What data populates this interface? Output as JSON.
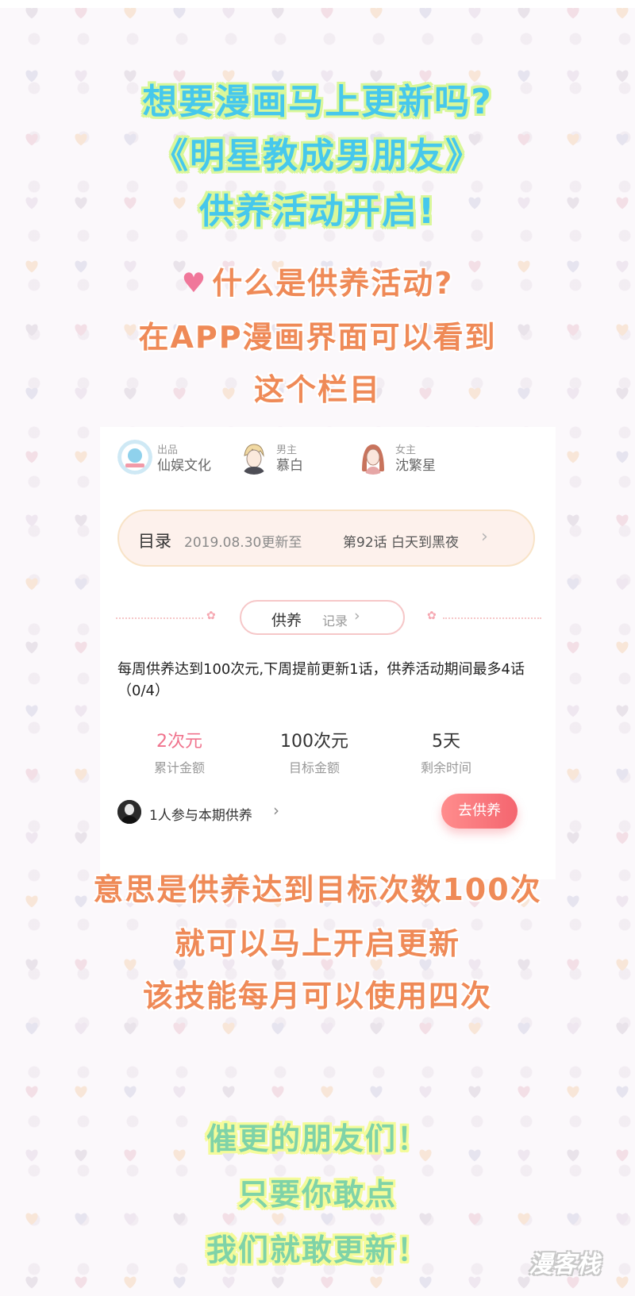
{
  "colors": {
    "headline_cyan": "#46c8ec",
    "body_orange": "#ef8a57",
    "closing_green": "#7fd3a8",
    "accent_pink": "#f0738d",
    "button_red": "#f4656f"
  },
  "intro": {
    "line1": "想要漫画马上更新吗?",
    "line2": "《明星教成男朋友》",
    "line3": "供养活动开启!"
  },
  "question": {
    "icon": "heart-icon",
    "line1": "什么是供养活动?",
    "line2": "在APP漫画界面可以看到",
    "line3": "这个栏目"
  },
  "card": {
    "creators": [
      {
        "role": "出品",
        "name": "仙娱文化",
        "icon": "publisher-avatar"
      },
      {
        "role": "男主",
        "name": "慕白",
        "icon": "male-lead-avatar"
      },
      {
        "role": "女主",
        "name": "沈繁星",
        "icon": "female-lead-avatar"
      }
    ],
    "toc": {
      "label": "目录",
      "date": "2019.08.30更新至",
      "chapter": "第92话 白天到黑夜",
      "icon": "chevron-right-icon"
    },
    "tabs": {
      "active": "供养",
      "secondary": "记录"
    },
    "rule": "每周供养达到100次元,下周提前更新1话，供养活动期间最多4话（0/4）",
    "stats": [
      {
        "value": "2次元",
        "label": "累计金额"
      },
      {
        "value": "100次元",
        "label": "目标金额"
      },
      {
        "value": "5天",
        "label": "剩余时间"
      }
    ],
    "participants": "1人参与本期供养",
    "support_button": "去供养"
  },
  "explanation": {
    "line1": "意思是供养达到目标次数100次",
    "line2": "就可以马上开启更新",
    "line3": "该技能每月可以使用四次"
  },
  "closing": {
    "line1": "催更的朋友们！",
    "line2": "只要你敢点",
    "line3": "我们就敢更新！"
  },
  "watermark": "漫客栈"
}
